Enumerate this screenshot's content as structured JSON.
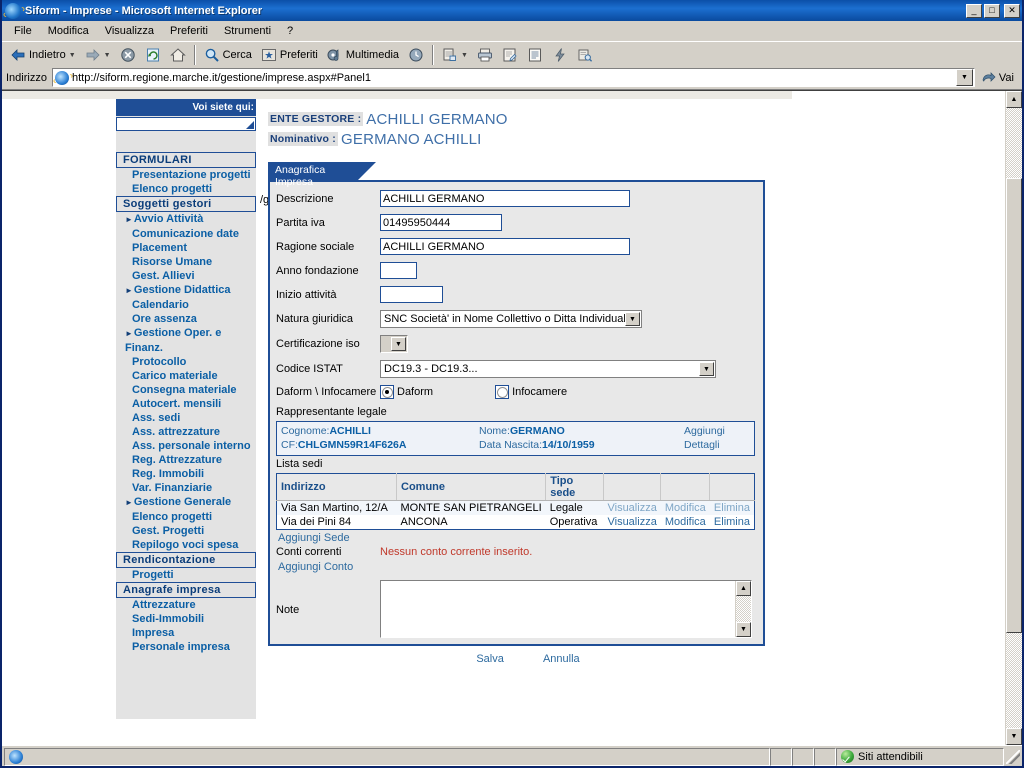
{
  "window": {
    "title": "Siform - Imprese - Microsoft Internet Explorer",
    "minimize": "_",
    "maximize": "□",
    "close": "✕"
  },
  "menu": [
    {
      "label": "File"
    },
    {
      "label": "Modifica"
    },
    {
      "label": "Visualizza"
    },
    {
      "label": "Preferiti"
    },
    {
      "label": "Strumenti"
    },
    {
      "label": "?"
    }
  ],
  "toolbar": {
    "back": "Indietro",
    "forward": "",
    "stop": "",
    "refresh": "",
    "home": "",
    "search": "Cerca",
    "favorites": "Preferiti",
    "media": "Multimedia",
    "history": "",
    "mail": "",
    "print": "",
    "edit": "",
    "discuss": "",
    "messenger": "",
    "research": ""
  },
  "address": {
    "label": "Indirizzo",
    "url": "http://siform.regione.marche.it/gestione/imprese.aspx#Panel1",
    "go": "Vai"
  },
  "nav": {
    "breadcrumb_label": "Voi siete qui:",
    "breadcrumb_path": "/gestione/imprese.aspx",
    "search_value": "",
    "items": [
      {
        "type": "section",
        "label": "FORMULARI"
      },
      {
        "type": "link",
        "label": "Presentazione progetti"
      },
      {
        "type": "link",
        "label": "Elenco progetti"
      },
      {
        "type": "section",
        "label": "Soggetti gestori"
      },
      {
        "type": "group",
        "label": "Avvio Attività"
      },
      {
        "type": "link",
        "label": "Comunicazione date"
      },
      {
        "type": "link",
        "label": "Placement"
      },
      {
        "type": "link",
        "label": "Risorse Umane"
      },
      {
        "type": "link",
        "label": "Gest. Allievi"
      },
      {
        "type": "group",
        "label": "Gestione Didattica"
      },
      {
        "type": "link",
        "label": "Calendario"
      },
      {
        "type": "link",
        "label": "Ore assenza"
      },
      {
        "type": "group",
        "label": "Gestione Oper. e Finanz."
      },
      {
        "type": "link",
        "label": "Protocollo"
      },
      {
        "type": "link",
        "label": "Carico materiale"
      },
      {
        "type": "link",
        "label": "Consegna materiale"
      },
      {
        "type": "link",
        "label": "Autocert. mensili"
      },
      {
        "type": "link",
        "label": "Ass. sedi"
      },
      {
        "type": "link",
        "label": "Ass. attrezzature"
      },
      {
        "type": "link",
        "label": "Ass. personale interno"
      },
      {
        "type": "link",
        "label": "Reg. Attrezzature"
      },
      {
        "type": "link",
        "label": "Reg. Immobili"
      },
      {
        "type": "link",
        "label": "Var. Finanziarie"
      },
      {
        "type": "group",
        "label": "Gestione Generale"
      },
      {
        "type": "link",
        "label": "Elenco progetti"
      },
      {
        "type": "link",
        "label": "Gest. Progetti"
      },
      {
        "type": "link",
        "label": "Repilogo voci spesa"
      },
      {
        "type": "section",
        "label": "Rendicontazione"
      },
      {
        "type": "link",
        "label": "Progetti"
      },
      {
        "type": "section",
        "label": "Anagrafe impresa"
      },
      {
        "type": "link",
        "label": "Attrezzature"
      },
      {
        "type": "link",
        "label": "Sedi-Immobili"
      },
      {
        "type": "link",
        "label": "Impresa"
      },
      {
        "type": "link",
        "label": "Personale impresa"
      }
    ]
  },
  "header": {
    "ente_key": "ENTE GESTORE :",
    "ente_value": "ACHILLI GERMANO",
    "nominativo_key": "Nominativo :",
    "nominativo_value": "GERMANO ACHILLI"
  },
  "tab": {
    "label": "Anagrafica Impresa"
  },
  "form": {
    "descrizione": {
      "label": "Descrizione",
      "value": "ACHILLI GERMANO"
    },
    "partita_iva": {
      "label": "Partita iva",
      "value": "01495950444"
    },
    "ragione_sociale": {
      "label": "Ragione sociale",
      "value": "ACHILLI GERMANO"
    },
    "anno_fondazione": {
      "label": "Anno fondazione",
      "value": ""
    },
    "inizio_attivita": {
      "label": "Inizio attività",
      "value": ""
    },
    "natura_giuridica": {
      "label": "Natura giuridica",
      "value": "SNC Società' in Nome Collettivo o Ditta Individuale"
    },
    "certificazione_iso": {
      "label": "Certificazione iso",
      "value": ""
    },
    "codice_istat": {
      "label": "Codice ISTAT",
      "value": "DC19.3 - DC19.3..."
    },
    "daform_infocamere": {
      "label": "Daform \\ Infocamere",
      "option_a": "Daform",
      "option_b": "Infocamere",
      "selected": "Daform"
    }
  },
  "rappresentante": {
    "section_label": "Rappresentante legale",
    "cognome_key": "Cognome:",
    "cognome_value": "ACHILLI",
    "nome_key": "Nome:",
    "nome_value": "GERMANO",
    "cf_key": "CF:",
    "cf_value": "CHLGMN59R14F626A",
    "nascita_key": "Data Nascita:",
    "nascita_value": "14/10/1959",
    "aggiungi": "Aggiungi",
    "dettagli": "Dettagli"
  },
  "sedi": {
    "section_label": "Lista sedi",
    "columns": [
      "Indirizzo",
      "Comune",
      "Tipo sede",
      "",
      "",
      ""
    ],
    "rows": [
      {
        "indirizzo": "Via San Martino, 12/A",
        "comune": "MONTE SAN PIETRANGELI",
        "tipo": "Legale",
        "visualizza": "Visualizza",
        "modifica": "Modifica",
        "elimina": "Elimina"
      },
      {
        "indirizzo": "Via dei Pini 84",
        "comune": "ANCONA",
        "tipo": "Operativa",
        "visualizza": "Visualizza",
        "modifica": "Modifica",
        "elimina": "Elimina"
      }
    ],
    "aggiungi_sede": "Aggiungi Sede"
  },
  "conti": {
    "label": "Conti correnti",
    "message": "Nessun conto corrente inserito.",
    "aggiungi_conto": "Aggiungi Conto"
  },
  "note": {
    "label": "Note",
    "value": ""
  },
  "actions": {
    "salva": "Salva",
    "annulla": "Annulla"
  },
  "statusbar": {
    "message": "",
    "zone": "Siti attendibili"
  },
  "colors": {
    "titlebar_blue": "#0b4fa8",
    "accent_blue": "#1f4e96",
    "link_blue": "#0b5fa5",
    "soft_link": "#2d6a9f",
    "warn_red": "#c0392b",
    "chrome_grey": "#d4d0c8",
    "nav_bg": "#e3e3e3",
    "panel_bg": "#e8e8e8"
  }
}
